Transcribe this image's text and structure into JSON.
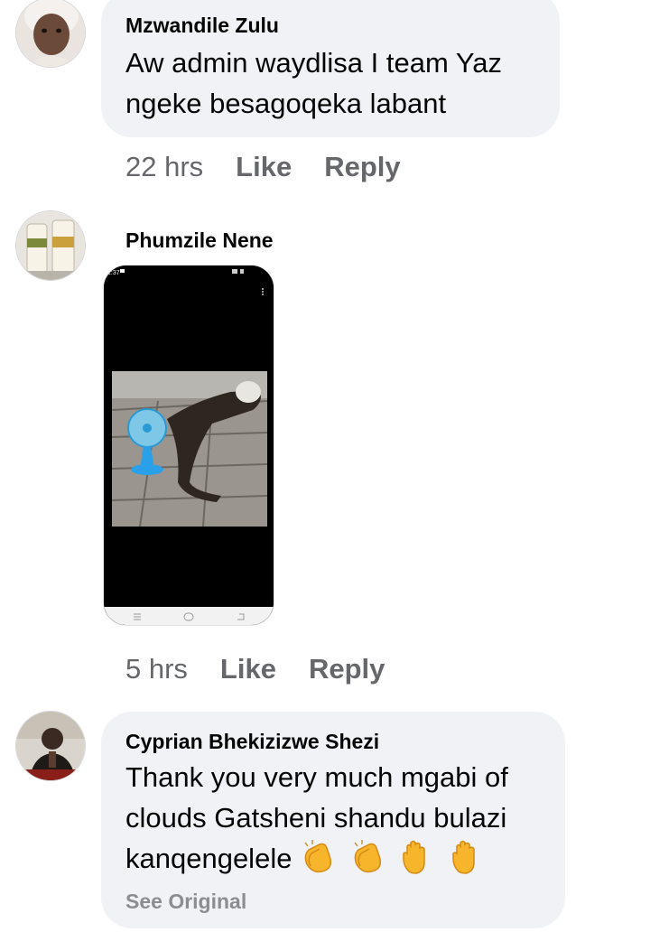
{
  "comments": [
    {
      "author": "Mzwandile Zulu",
      "lines": [
        "Aw admin waydlisa I team Yaz",
        "ngeke besagoqeka labant"
      ],
      "time": "22 hrs",
      "like_label": "Like",
      "reply_label": "Reply"
    },
    {
      "author": "Phumzile Nene",
      "attachment": {
        "type": "phone-screenshot-photo",
        "status_time": "1:37"
      },
      "time": "5 hrs",
      "like_label": "Like",
      "reply_label": "Reply"
    },
    {
      "author": "Cyprian Bhekizizwe Shezi",
      "lines": [
        "Thank you very much mgabi of",
        "clouds Gatsheni shandu bulazi",
        "kanqengelele"
      ],
      "emojis": [
        "clapping-hands-icon",
        "clapping-hands-icon",
        "raised-hand-icon",
        "raised-hand-icon"
      ],
      "see_original_label": "See Original"
    }
  ],
  "colors": {
    "bubble": "#f0f2f5",
    "text": "#050505",
    "meta": "#65676b",
    "see_original": "#8a8d91"
  }
}
